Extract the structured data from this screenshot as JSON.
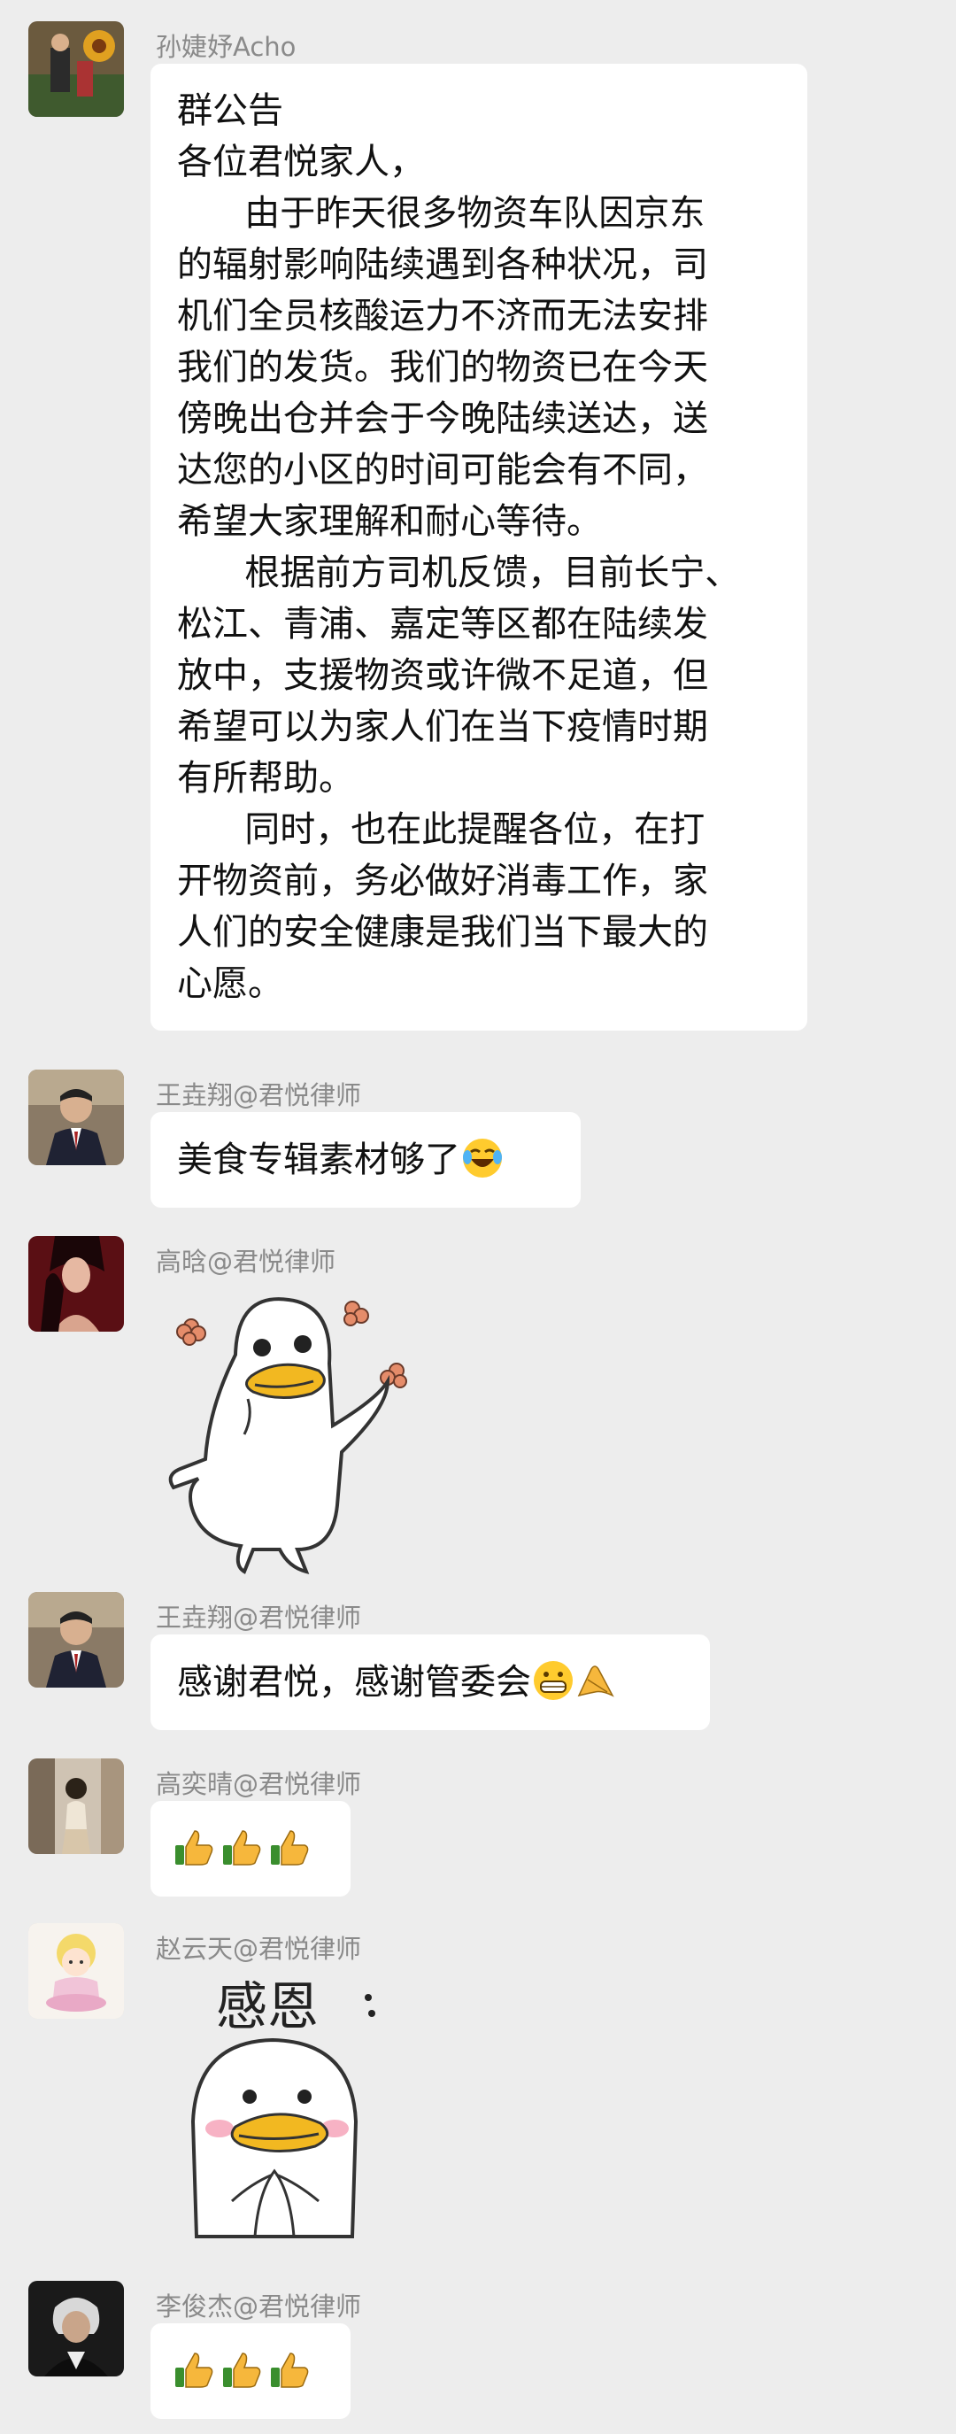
{
  "messages": [
    {
      "sender": "孙婕妤Acho",
      "announcement": {
        "title": "群公告",
        "greeting": "各位君悦家人，",
        "lines": [
          "      由于昨天很多物资车队因京东",
          "的辐射影响陆续遇到各种状况，司",
          "机们全员核酸运力不济而无法安排",
          "我们的发货。我们的物资已在今天",
          "傍晚出仓并会于今晚陆续送达，送",
          "达您的小区的时间可能会有不同，",
          "希望大家理解和耐心等待。",
          "      根据前方司机反馈，目前长宁、",
          "松江、青浦、嘉定等区都在陆续发",
          "放中，支援物资或许微不足道，但",
          "希望可以为家人们在当下疫情时期",
          "有所帮助。",
          "      同时，也在此提醒各位，在打",
          "开物资前，务必做好消毒工作，家",
          "人们的安全健康是我们当下最大的",
          "心愿。"
        ]
      }
    },
    {
      "sender": "王垚翔@君悦律师",
      "text": "美食专辑素材够了",
      "emoji": "laugh-cry"
    },
    {
      "sender": "高晗@君悦律师",
      "sticker": "duck-dancing"
    },
    {
      "sender": "王垚翔@君悦律师",
      "text": "感谢君悦，感谢管委会",
      "emoji": "grin-bow"
    },
    {
      "sender": "高奕晴@君悦律师",
      "thumbs": 3
    },
    {
      "sender": "赵云天@君悦律师",
      "sticker": "duck-thanks",
      "sticker_text": "感恩"
    },
    {
      "sender": "李俊杰@君悦律师",
      "thumbs": 3
    }
  ]
}
